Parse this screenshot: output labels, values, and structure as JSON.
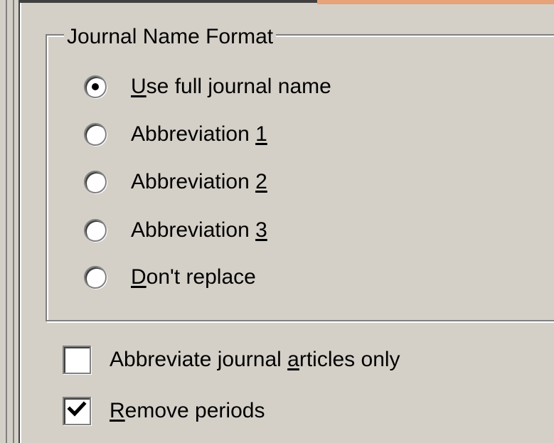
{
  "group": {
    "title": "Journal Name Format"
  },
  "options": [
    {
      "prefix": "",
      "mnemonic": "U",
      "suffix": "se full journal name",
      "checked": true
    },
    {
      "prefix": "Abbreviation ",
      "mnemonic": "1",
      "suffix": "",
      "checked": false
    },
    {
      "prefix": "Abbreviation ",
      "mnemonic": "2",
      "suffix": "",
      "checked": false
    },
    {
      "prefix": "Abbreviation ",
      "mnemonic": "3",
      "suffix": "",
      "checked": false
    },
    {
      "prefix": "",
      "mnemonic": "D",
      "suffix": "on't replace",
      "checked": false
    }
  ],
  "checkboxes": [
    {
      "prefix": "Abbreviate journal ",
      "mnemonic": "a",
      "suffix": "rticles only",
      "checked": false
    },
    {
      "prefix": "",
      "mnemonic": "R",
      "suffix": "emove periods",
      "checked": true
    }
  ],
  "colors": {
    "dialog_bg": "#d4d0c8",
    "shadow": "#808080",
    "highlight": "#ffffff",
    "accent_top": "#e8a27a"
  },
  "icons": {
    "radio_checked": "radio-dot",
    "checkbox_checked": "check-mark"
  }
}
